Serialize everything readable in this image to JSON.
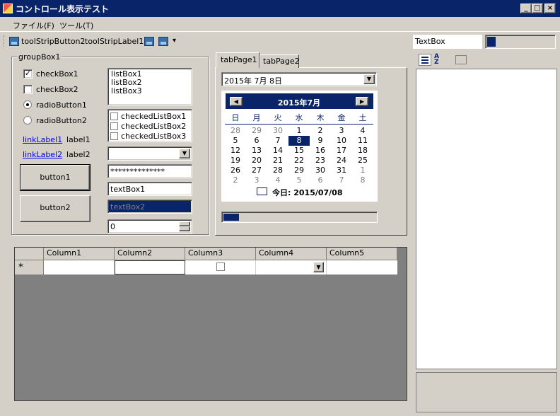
{
  "window": {
    "title": "コントロール表示テスト",
    "min": "_",
    "max": "□",
    "close": "×"
  },
  "menu": [
    "ファイル(F)",
    "ツール(T)"
  ],
  "toolstrip": {
    "button2": "toolStripButton2",
    "label1": "toolStripLabel1",
    "textbox": "TextBox",
    "dropdown": "▾"
  },
  "groupbox": {
    "title": "groupBox1",
    "checkbox1": "checkBox1",
    "checkbox2": "checkBox2",
    "radio1": "radioButton1",
    "radio2": "radioButton2",
    "linklabel1": "linkLabel1",
    "label1": "label1",
    "linklabel2": "linkLabel2",
    "label2": "label2",
    "button1": "button1",
    "button2": "button2",
    "listbox": [
      "listBox1",
      "listBox2",
      "listBox3"
    ],
    "checkedlist": [
      "checkedListBox1",
      "checkedListBox2",
      "checkedListBox3"
    ],
    "password": "**************",
    "textbox1": "textBox1",
    "textbox2": "textBox2",
    "numeric": "0"
  },
  "tabs": [
    "tabPage1",
    "tabPage2"
  ],
  "datepicker": {
    "value": "2015年 7月 8日"
  },
  "calendar": {
    "month_title": "2015年7月",
    "weekdays": [
      "日",
      "月",
      "火",
      "水",
      "木",
      "金",
      "土"
    ],
    "weeks": [
      [
        "28",
        "29",
        "30",
        "1",
        "2",
        "3",
        "4"
      ],
      [
        "5",
        "6",
        "7",
        "8",
        "9",
        "10",
        "11"
      ],
      [
        "12",
        "13",
        "14",
        "15",
        "16",
        "17",
        "18"
      ],
      [
        "19",
        "20",
        "21",
        "22",
        "23",
        "24",
        "25"
      ],
      [
        "26",
        "27",
        "28",
        "29",
        "30",
        "31",
        "1"
      ],
      [
        "2",
        "3",
        "4",
        "5",
        "6",
        "7",
        "8"
      ]
    ],
    "selected": "8",
    "today_label": "今日: 2015/07/08"
  },
  "progress": {
    "toolstrip": 0.12,
    "tab": 0.1
  },
  "grid": {
    "columns": [
      "Column1",
      "Column2",
      "Column3",
      "Column4",
      "Column5"
    ],
    "new_row_marker": "*"
  }
}
